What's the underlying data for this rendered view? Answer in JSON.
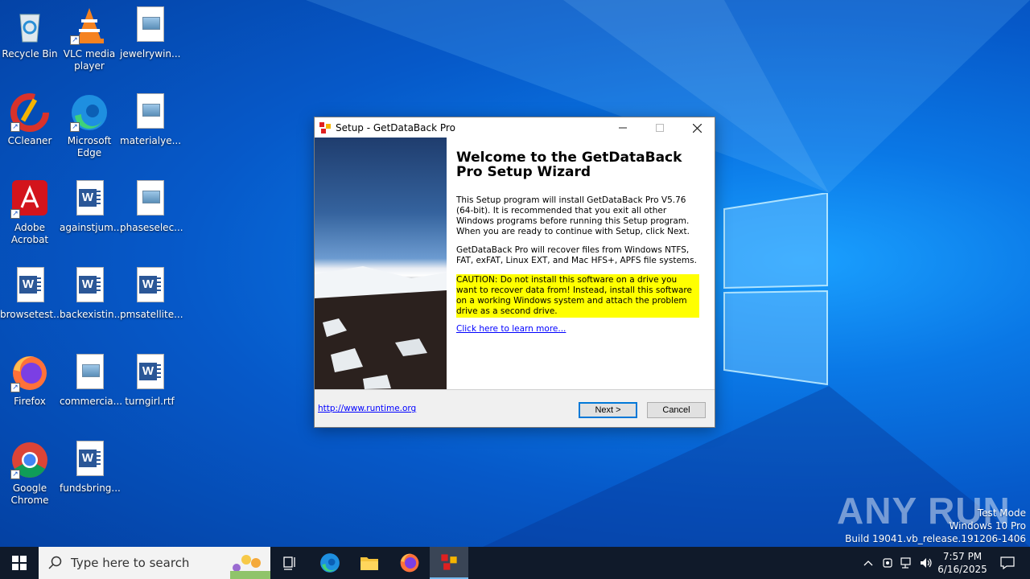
{
  "desktop": {
    "icons": [
      {
        "label": "Recycle Bin"
      },
      {
        "label": "VLC media player"
      },
      {
        "label": "jewelrywin..."
      },
      {
        "label": "CCleaner"
      },
      {
        "label": "Microsoft Edge"
      },
      {
        "label": "materialye..."
      },
      {
        "label": "Adobe Acrobat"
      },
      {
        "label": "againstjum..."
      },
      {
        "label": "phaseselec..."
      },
      {
        "label": "browsetest..."
      },
      {
        "label": "backexistin..."
      },
      {
        "label": "pmsatellite..."
      },
      {
        "label": "Firefox"
      },
      {
        "label": "commercia..."
      },
      {
        "label": "turngirl.rtf"
      },
      {
        "label": "Google Chrome"
      },
      {
        "label": "fundsbring..."
      }
    ]
  },
  "dialog": {
    "title": "Setup - GetDataBack Pro",
    "heading": "Welcome to the GetDataBack Pro Setup Wizard",
    "para1": "This Setup program will install GetDataBack Pro V5.76 (64-bit). It is recommended that you exit all other Windows programs before running this Setup program. When you are ready to continue with Setup, click Next.",
    "para2": "GetDataBack Pro will recover files from Windows NTFS, FAT, exFAT, Linux EXT, and Mac HFS+, APFS file systems.",
    "caution": "CAUTION: Do not install this software on a drive you want to recover data from! Instead, install this software on a working Windows system and attach the problem drive as a second drive.",
    "learn_more": "Click here to learn more...",
    "footer_link": "http://www.runtime.org",
    "next_label": "Next >",
    "cancel_label": "Cancel"
  },
  "watermark": {
    "brand": "ANY RUN",
    "line1": "Test Mode",
    "line2": "Windows 10 Pro",
    "line3": "Build 19041.vb_release.191206-1406"
  },
  "taskbar": {
    "search_placeholder": "Type here to search",
    "time": "7:57 PM",
    "date": "6/16/2025"
  },
  "colors": {
    "desktop_blue": "#0a78e6",
    "caution_highlight": "#ffff00",
    "taskbar": "#101a2a",
    "link": "#0000ff"
  }
}
